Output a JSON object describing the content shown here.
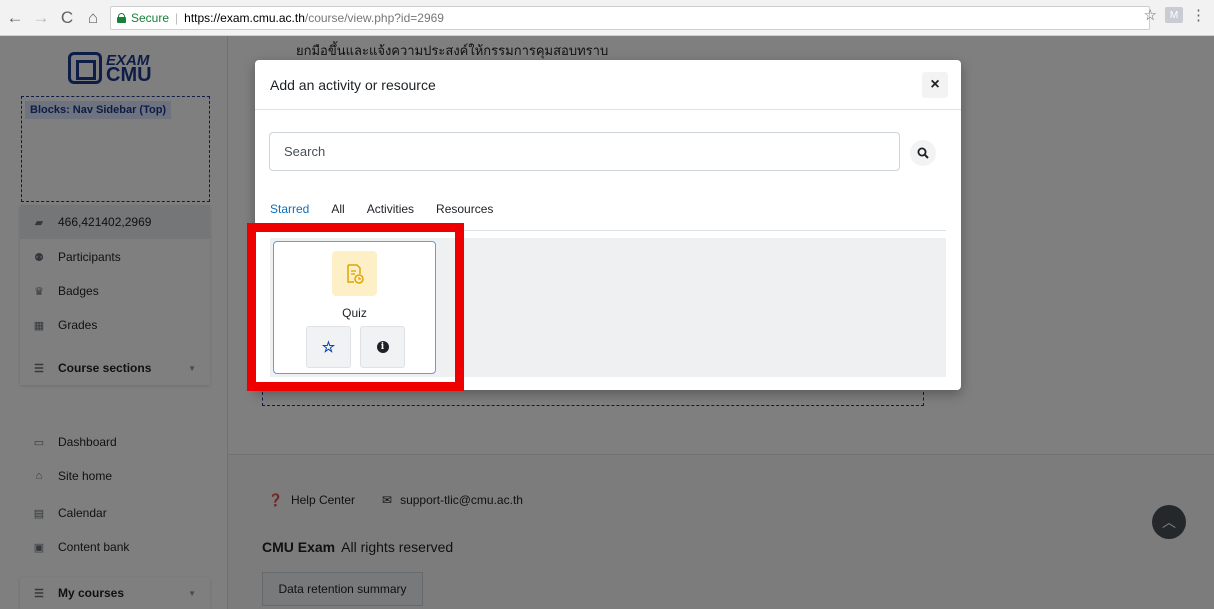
{
  "browser": {
    "back_icon": "←",
    "forward_icon": "→",
    "reload_icon": "C",
    "home_icon": "⌂",
    "secure_label": "Secure",
    "url_scheme_host": "https://exam.cmu.ac.th",
    "url_path": "/course/view.php?id=2969",
    "bookmark_icon": "☆",
    "extension_label": "M",
    "menu_icon": "⋮"
  },
  "sidebar": {
    "logo_top": "EXAM",
    "logo_bottom": "CMU",
    "block_label": "Blocks: Nav Sidebar (Top)",
    "course_items": [
      {
        "label": "466,421402,2969",
        "icon": "graduation-cap-icon"
      },
      {
        "label": "Participants",
        "icon": "users-icon"
      },
      {
        "label": "Badges",
        "icon": "trophy-icon"
      },
      {
        "label": "Grades",
        "icon": "table-icon"
      },
      {
        "label": "Course sections",
        "icon": "list-icon"
      }
    ],
    "site_items": [
      {
        "label": "Dashboard",
        "icon": "dashboard-icon"
      },
      {
        "label": "Site home",
        "icon": "home-icon"
      },
      {
        "label": "Calendar",
        "icon": "calendar-icon"
      },
      {
        "label": "Content bank",
        "icon": "content-bank-icon"
      }
    ],
    "my_courses": "My courses"
  },
  "main": {
    "instruction_text": "ยกมือขึ้นและแจ้งความประสงค์ให้กรรมการคุมสอบทราบ"
  },
  "footer": {
    "help_center": "Help Center",
    "support_email": "support-tlic@cmu.ac.th",
    "brand": "CMU Exam",
    "rights": "All rights reserved",
    "data_retention": "Data retention summary"
  },
  "modal": {
    "title": "Add an activity or resource",
    "close_icon": "×",
    "search_placeholder": "Search",
    "tabs": [
      "Starred",
      "All",
      "Activities",
      "Resources"
    ],
    "active_tab": "Starred",
    "card": {
      "name": "Quiz",
      "star_icon": "☆",
      "info_icon": "i"
    }
  },
  "colors": {
    "accent": "#0f6cbf",
    "brand_blue": "#1a3a8f",
    "highlight_red": "#ee0000",
    "quiz_icon_bg": "#fdf0c7"
  }
}
